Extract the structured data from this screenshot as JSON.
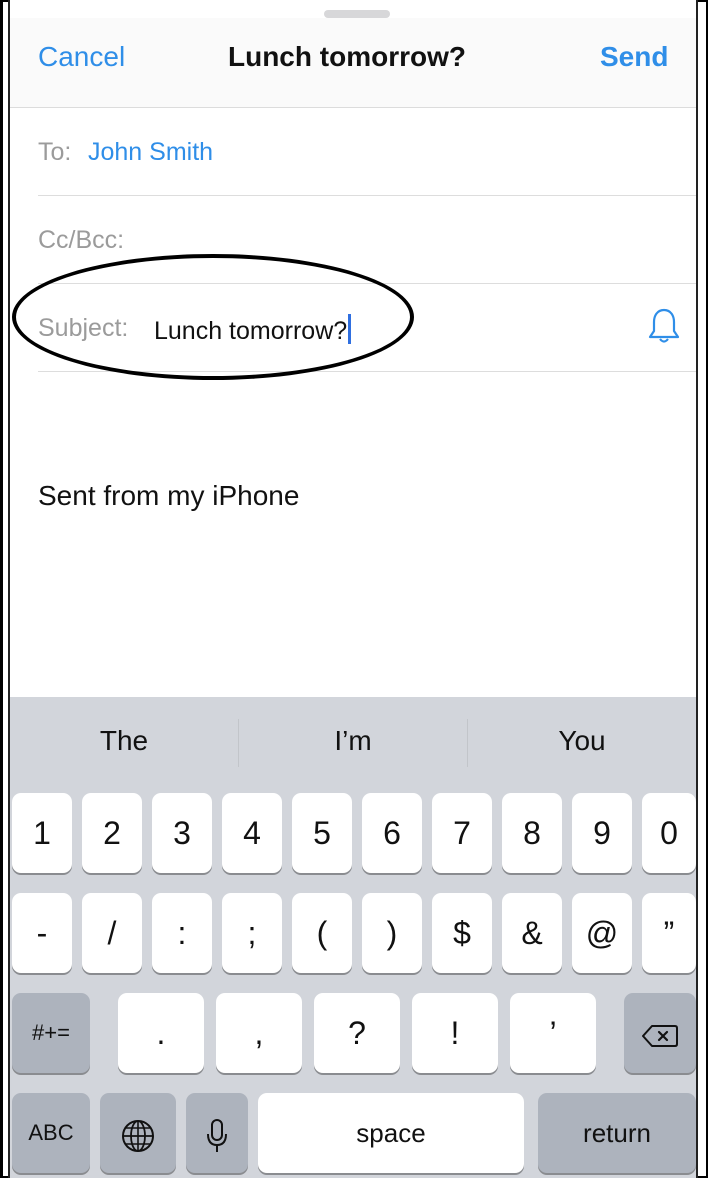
{
  "nav": {
    "cancel_label": "Cancel",
    "title": "Lunch tomorrow?",
    "send_label": "Send"
  },
  "fields": {
    "to_label": "To:",
    "to_value": "John Smith",
    "cc_label": "Cc/Bcc:",
    "subject_label": "Subject:",
    "subject_value": "Lunch tomorrow?"
  },
  "body": {
    "signature": "Sent from my iPhone"
  },
  "keyboard": {
    "suggestions": [
      "The",
      "I’m",
      "You"
    ],
    "row1": [
      "1",
      "2",
      "3",
      "4",
      "5",
      "6",
      "7",
      "8",
      "9",
      "0"
    ],
    "row2": [
      "-",
      "/",
      ":",
      ";",
      "(",
      ")",
      "$",
      "&",
      "@",
      "”"
    ],
    "row3": {
      "shift": "#+=",
      "keys": [
        ".",
        ",",
        "?",
        "!",
        "’"
      ]
    },
    "row4": {
      "abc": "ABC",
      "space": "space",
      "return": "return"
    }
  },
  "icons": {
    "bell": "bell-icon",
    "delete": "delete-icon",
    "globe": "globe-icon",
    "mic": "microphone-icon"
  },
  "colors": {
    "accent": "#2f8ee8",
    "keyboard_bg": "#d2d5db",
    "dark_key": "#adb3bd"
  }
}
